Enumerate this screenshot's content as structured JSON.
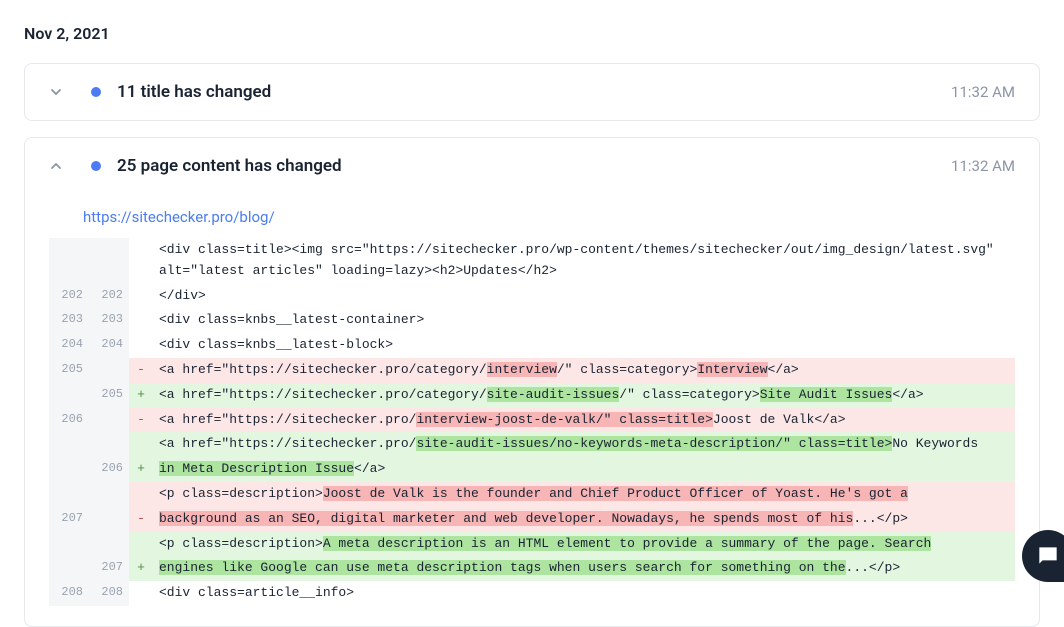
{
  "date": "Nov 2, 2021",
  "events": [
    {
      "title": "11 title has changed",
      "time": "11:32 AM",
      "expanded": false
    },
    {
      "title": "25 page content has changed",
      "time": "11:32 AM",
      "expanded": true,
      "url": "https://sitechecker.pro/blog/",
      "diff": [
        {
          "old": "",
          "new": "",
          "sign": "",
          "type": "ctx",
          "segments": [
            {
              "t": "<div class=title><img src=\"https://sitechecker.pro/wp-content/themes/sitechecker/out/img_design/latest.svg\" alt=\"latest articles\" loading=lazy><h2>Updates</h2>"
            }
          ]
        },
        {
          "old": "202",
          "new": "202",
          "sign": "",
          "type": "ctx",
          "segments": [
            {
              "t": "</div>"
            }
          ]
        },
        {
          "old": "203",
          "new": "203",
          "sign": "",
          "type": "ctx",
          "segments": [
            {
              "t": "<div class=knbs__latest-container>"
            }
          ]
        },
        {
          "old": "204",
          "new": "204",
          "sign": "",
          "type": "ctx",
          "segments": [
            {
              "t": "<div class=knbs__latest-block>"
            }
          ]
        },
        {
          "old": "205",
          "new": "",
          "sign": "-",
          "type": "del",
          "segments": [
            {
              "t": "<a href=\"https://sitechecker.pro/category/"
            },
            {
              "t": "interview",
              "hl": "del"
            },
            {
              "t": "/\" class=category>"
            },
            {
              "t": "Interview",
              "hl": "del"
            },
            {
              "t": "</a>"
            }
          ]
        },
        {
          "old": "",
          "new": "205",
          "sign": "+",
          "type": "add",
          "segments": [
            {
              "t": "<a href=\"https://sitechecker.pro/category/"
            },
            {
              "t": "site-audit-issues",
              "hl": "add"
            },
            {
              "t": "/\" class=category>"
            },
            {
              "t": "Site Audit Issues",
              "hl": "add"
            },
            {
              "t": "</a>"
            }
          ]
        },
        {
          "old": "206",
          "new": "",
          "sign": "-",
          "type": "del",
          "segments": [
            {
              "t": "<a href=\"https://sitechecker.pro/"
            },
            {
              "t": "interview-joost-de-valk/\" class=title>",
              "hl": "del"
            },
            {
              "t": "Joost de Valk</a>"
            }
          ]
        },
        {
          "old": "",
          "new": "",
          "sign": "",
          "type": "add",
          "segments": [
            {
              "t": "<a href=\"https://sitechecker.pro/"
            },
            {
              "t": "site-audit-issues/no-keywords-meta-description/\" class=title>",
              "hl": "add"
            },
            {
              "t": "No Keywords"
            }
          ]
        },
        {
          "old": "",
          "new": "206",
          "sign": "+",
          "type": "add",
          "segments": [
            {
              "t": "in Meta Description Issue",
              "hl": "add"
            },
            {
              "t": "</a>"
            }
          ]
        },
        {
          "old": "",
          "new": "",
          "sign": "",
          "type": "del",
          "segments": [
            {
              "t": "<p class=description>"
            },
            {
              "t": "Joost de Valk is the founder and Chief Product Officer of Yoast. He's got a",
              "hl": "del"
            }
          ]
        },
        {
          "old": "207",
          "new": "",
          "sign": "-",
          "type": "del",
          "segments": [
            {
              "t": "background as an SEO, digital marketer and web developer. Nowadays, he spends most of his",
              "hl": "del"
            },
            {
              "t": "...</p>"
            }
          ]
        },
        {
          "old": "",
          "new": "",
          "sign": "",
          "type": "add",
          "segments": [
            {
              "t": "<p class=description>"
            },
            {
              "t": "A meta description is an HTML element to provide a summary of the page. Search",
              "hl": "add"
            }
          ]
        },
        {
          "old": "",
          "new": "207",
          "sign": "+",
          "type": "add",
          "segments": [
            {
              "t": "engines like Google can use meta description tags when users search for something on the",
              "hl": "add"
            },
            {
              "t": "...</p>"
            }
          ]
        },
        {
          "old": "208",
          "new": "208",
          "sign": "",
          "type": "ctx",
          "segments": [
            {
              "t": "<div class=article__info>"
            }
          ]
        }
      ]
    }
  ]
}
